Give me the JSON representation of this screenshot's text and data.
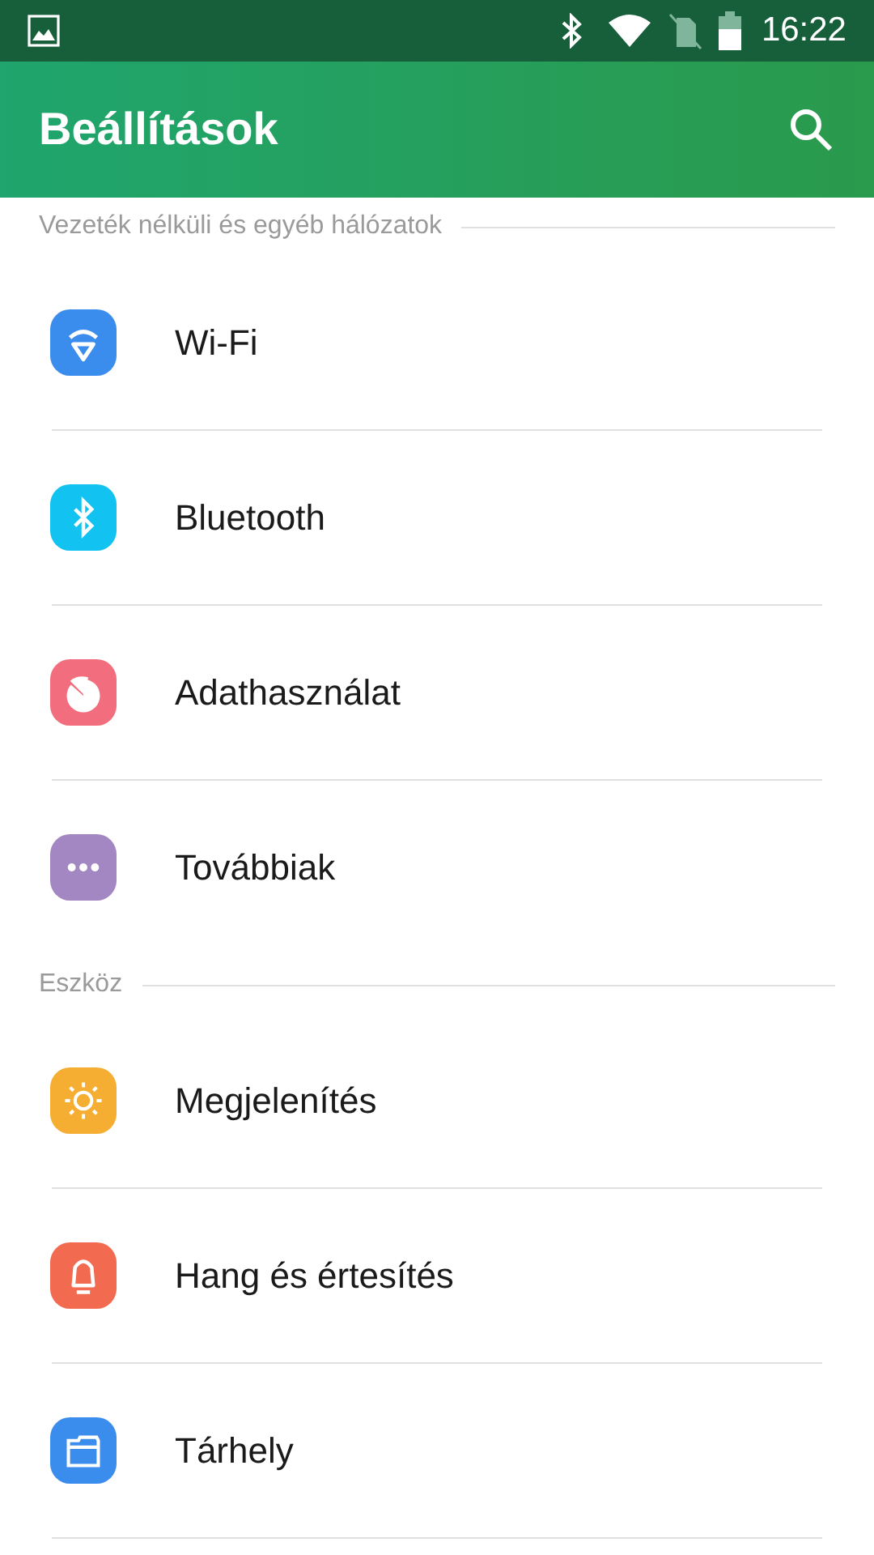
{
  "status_bar": {
    "time": "16:22"
  },
  "app_bar": {
    "title": "Beállítások"
  },
  "sections": [
    {
      "title": "Vezeték nélküli és egyéb hálózatok",
      "items": [
        {
          "label": "Wi-Fi",
          "kind": "wifi",
          "color": "#3b8ded"
        },
        {
          "label": "Bluetooth",
          "kind": "bluetooth",
          "color": "#12c2f0"
        },
        {
          "label": "Adathasználat",
          "kind": "pie",
          "color": "#f26d7d"
        },
        {
          "label": "Továbbiak",
          "kind": "more",
          "color": "#a287c2"
        }
      ]
    },
    {
      "title": "Eszköz",
      "items": [
        {
          "label": "Megjelenítés",
          "kind": "sun",
          "color": "#f5ad32"
        },
        {
          "label": "Hang és értesítés",
          "kind": "bell",
          "color": "#f26a50"
        },
        {
          "label": "Tárhely",
          "kind": "folder",
          "color": "#3b8ded"
        }
      ]
    }
  ]
}
